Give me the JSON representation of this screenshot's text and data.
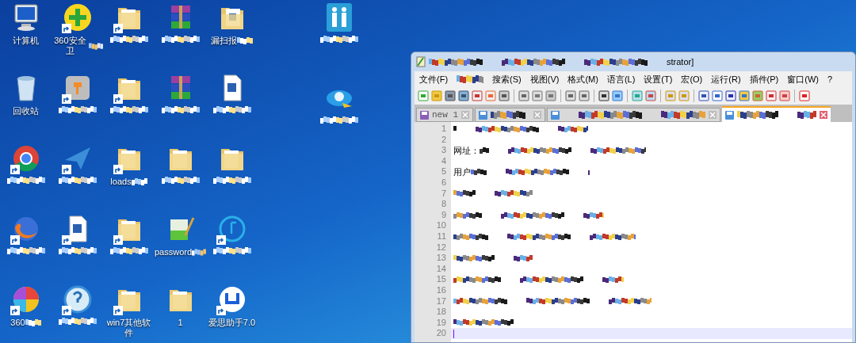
{
  "desktop": {
    "rows": [
      [
        {
          "kind": "computer",
          "label": "计算机",
          "shortcut": false,
          "obscured": false
        },
        {
          "kind": "plus-shield",
          "label": "360安全卫",
          "shortcut": true,
          "obscured": true
        },
        {
          "kind": "folder",
          "shortcut": true,
          "obscured": true
        },
        {
          "kind": "archive",
          "shortcut": false,
          "obscured": true
        },
        {
          "kind": "doc-folder",
          "label": "漏扫报",
          "shortcut": false,
          "obscured": true
        }
      ],
      [
        {
          "kind": "recycle-bin",
          "label": "回收站",
          "shortcut": false,
          "obscured": false
        },
        {
          "kind": "app",
          "shortcut": true,
          "obscured": true
        },
        {
          "kind": "folder",
          "shortcut": true,
          "obscured": true
        },
        {
          "kind": "archive",
          "shortcut": false,
          "obscured": true
        },
        {
          "kind": "document",
          "shortcut": false,
          "obscured": true
        }
      ],
      [
        {
          "kind": "browser",
          "shortcut": true,
          "obscured": true
        },
        {
          "kind": "plane",
          "shortcut": true,
          "obscured": true
        },
        {
          "kind": "folder",
          "label": "loads",
          "shortcut": true,
          "obscured": true
        },
        {
          "kind": "folder",
          "shortcut": false,
          "obscured": true
        },
        {
          "kind": "folder",
          "shortcut": false,
          "obscured": true
        }
      ],
      [
        {
          "kind": "fox",
          "shortcut": true,
          "obscured": true
        },
        {
          "kind": "document",
          "shortcut": true,
          "obscured": true
        },
        {
          "kind": "folder",
          "shortcut": true,
          "obscured": true
        },
        {
          "kind": "pencil",
          "label": "password",
          "shortcut": false,
          "obscured": true
        },
        {
          "kind": "music",
          "shortcut": true,
          "obscured": true
        }
      ],
      [
        {
          "kind": "pinwheel",
          "label": "360",
          "shortcut": true,
          "obscured": true
        },
        {
          "kind": "help",
          "shortcut": true,
          "obscured": true
        },
        {
          "kind": "folder",
          "label": "win7其他软件",
          "shortcut": true,
          "obscured": false
        },
        {
          "kind": "folder",
          "label": "1",
          "shortcut": false,
          "obscured": false
        },
        {
          "kind": "phone-app",
          "label": "爱思助手7.0",
          "shortcut": true,
          "obscured": false
        }
      ]
    ],
    "side_icons": [
      {
        "kind": "people",
        "shortcut": false,
        "obscured": true
      },
      {
        "kind": "eye",
        "shortcut": false,
        "obscured": true
      }
    ]
  },
  "editor_window": {
    "title": "strator]",
    "menu": [
      {
        "label": "文件(F)",
        "obscured": false
      },
      {
        "obscured": true
      },
      {
        "label": "搜索(S)",
        "obscured": false
      },
      {
        "label": "视图(V)",
        "obscured": false
      },
      {
        "label": "格式(M)",
        "obscured": false
      },
      {
        "label": "语言(L)",
        "obscured": false
      },
      {
        "label": "设置(T)",
        "obscured": false
      },
      {
        "label": "宏(O)",
        "obscured": false
      },
      {
        "label": "运行(R)",
        "obscured": false
      },
      {
        "label": "插件(P)",
        "obscured": false
      },
      {
        "label": "窗口(W)",
        "obscured": false
      },
      {
        "label": "?",
        "obscured": false
      }
    ],
    "tabs": [
      {
        "label": "new 1",
        "selected": false,
        "obscured": false
      },
      {
        "selected": false,
        "obscured": true
      },
      {
        "selected": false,
        "obscured": true
      },
      {
        "selected": true,
        "obscured": true
      }
    ],
    "lines": [
      {
        "number": "1",
        "obscured": true,
        "current": false
      },
      {
        "number": "2",
        "obscured": false,
        "current": false
      },
      {
        "number": "3",
        "text": "网址：",
        "obscured": true,
        "current": false
      },
      {
        "number": "4",
        "obscured": false,
        "current": false
      },
      {
        "number": "5",
        "text": "用户",
        "obscured": true,
        "current": false
      },
      {
        "number": "6",
        "obscured": false,
        "current": false
      },
      {
        "number": "7",
        "obscured": true,
        "current": false
      },
      {
        "number": "8",
        "obscured": false,
        "current": false
      },
      {
        "number": "9",
        "obscured": true,
        "current": false
      },
      {
        "number": "10",
        "obscured": false,
        "current": false
      },
      {
        "number": "11",
        "obscured": true,
        "current": false
      },
      {
        "number": "12",
        "obscured": false,
        "current": false
      },
      {
        "number": "13",
        "obscured": true,
        "current": false
      },
      {
        "number": "14",
        "obscured": false,
        "current": false
      },
      {
        "number": "15",
        "obscured": true,
        "current": false
      },
      {
        "number": "16",
        "obscured": false,
        "current": false
      },
      {
        "number": "17",
        "obscured": true,
        "current": false
      },
      {
        "number": "18",
        "obscured": false,
        "current": false
      },
      {
        "number": "19",
        "obscured": true,
        "current": false
      },
      {
        "number": "20",
        "obscured": false,
        "current": true
      }
    ]
  }
}
